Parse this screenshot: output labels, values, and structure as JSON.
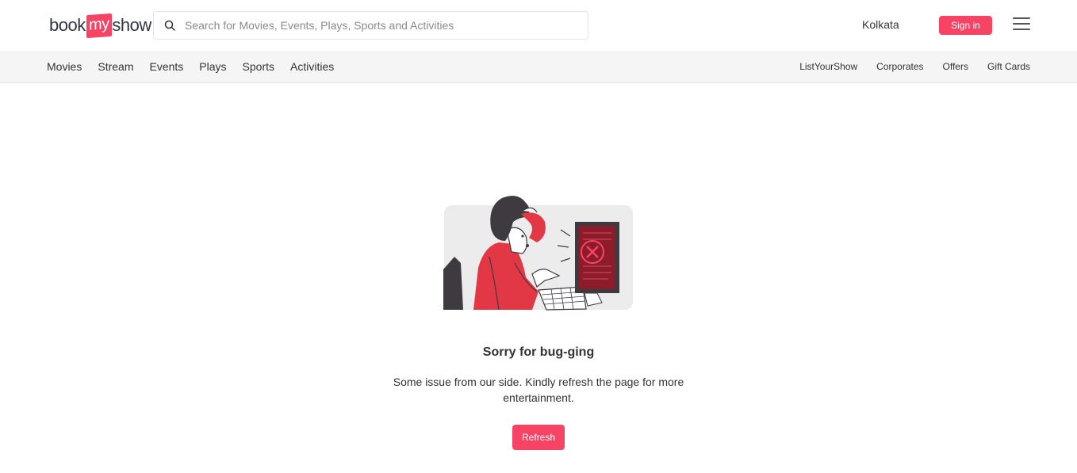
{
  "brand": {
    "part1": "book",
    "part2": "my",
    "part3": "show",
    "accent": "#f84464"
  },
  "search": {
    "placeholder": "Search for Movies, Events, Plays, Sports and Activities",
    "value": "",
    "icon": "search-icon"
  },
  "header": {
    "city": "Kolkata",
    "signin_label": "Sign in",
    "menu_icon": "hamburger-menu-icon"
  },
  "nav": {
    "left": [
      "Movies",
      "Stream",
      "Events",
      "Plays",
      "Sports",
      "Activities"
    ],
    "right": [
      "ListYourShow",
      "Corporates",
      "Offers",
      "Gift Cards"
    ]
  },
  "error": {
    "title": "Sorry for bug-ging",
    "message": "Some issue from our side. Kindly refresh the page for more entertainment.",
    "refresh_label": "Refresh",
    "illustration_icon": "confused-person-at-computer-illustration"
  }
}
